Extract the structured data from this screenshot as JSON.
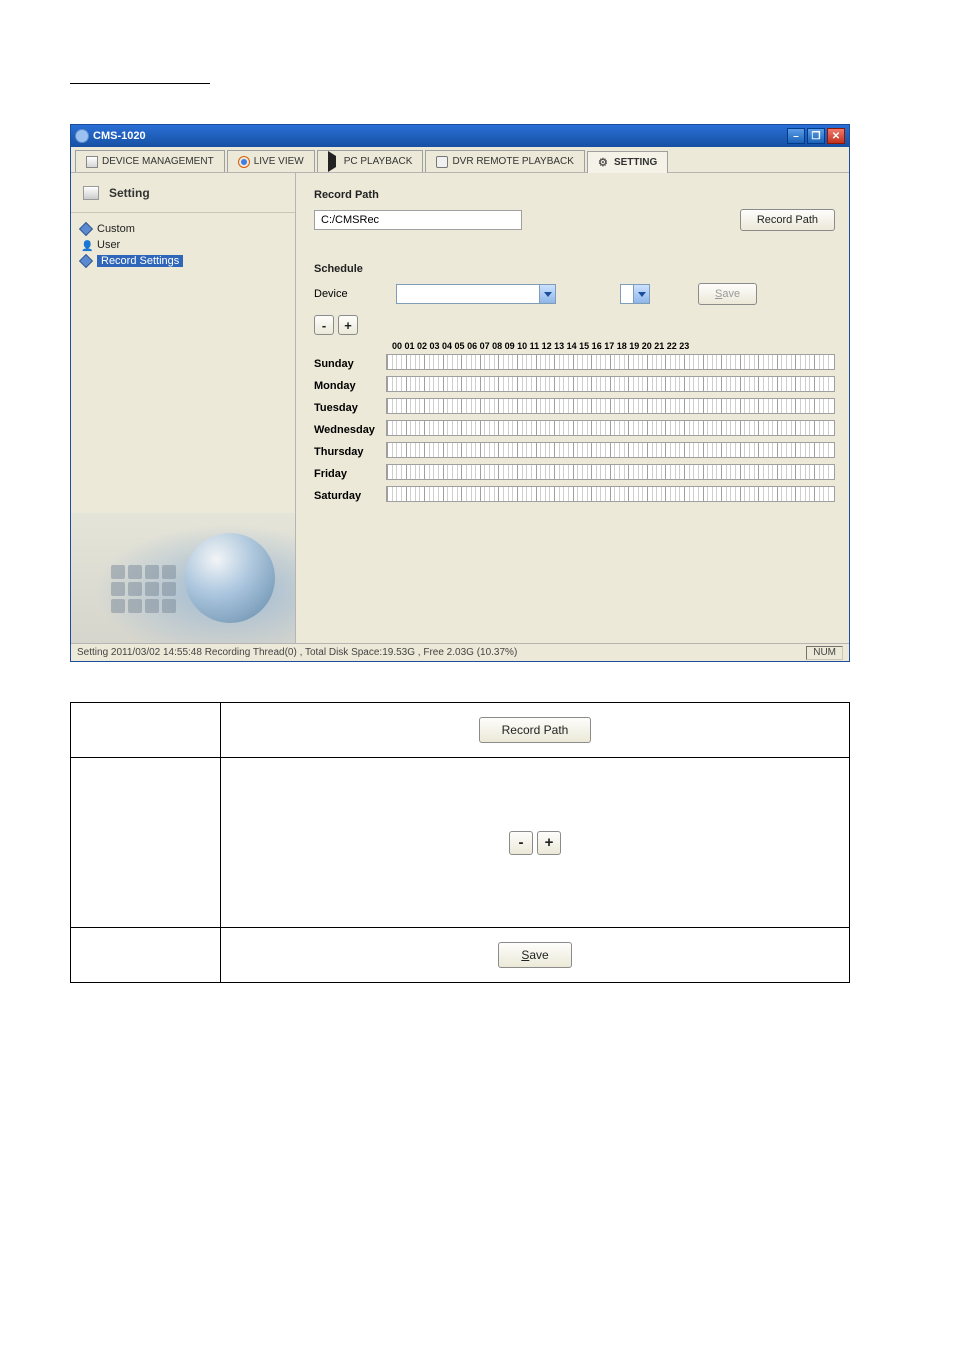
{
  "window": {
    "title": "CMS-1020"
  },
  "tabs": {
    "device_mgmt": "DEVICE MANAGEMENT",
    "live_view": "LIVE VIEW",
    "pc_playback": "PC PLAYBACK",
    "dvr_remote": "DVR REMOTE PLAYBACK",
    "setting": "SETTING"
  },
  "sidebar": {
    "header": "Setting",
    "items": {
      "custom": "Custom",
      "user": "User",
      "record_settings": "Record Settings"
    }
  },
  "content": {
    "record_path_label": "Record Path",
    "record_path_value": "C:/CMSRec",
    "record_path_btn": "Record Path",
    "schedule_label": "Schedule",
    "device_label": "Device",
    "save_btn": "Save",
    "minus": "-",
    "plus": "+",
    "hours_header": "00  01  02  03  04  05  06  07  08  09  10  11  12  13  14  15  16  17  18  19  20  21  22  23",
    "days": [
      "Sunday",
      "Monday",
      "Tuesday",
      "Wednesday",
      "Thursday",
      "Friday",
      "Saturday"
    ]
  },
  "status": {
    "text": "Setting  2011/03/02 14:55:48   Recording Thread(0) , Total Disk Space:19.53G , Free 2.03G (10.37%)",
    "indicator": "NUM"
  },
  "spec": {
    "record_path_btn": "Record Path",
    "minus": "-",
    "plus": "+",
    "save_prefix": "S",
    "save_suffix": "ave"
  }
}
